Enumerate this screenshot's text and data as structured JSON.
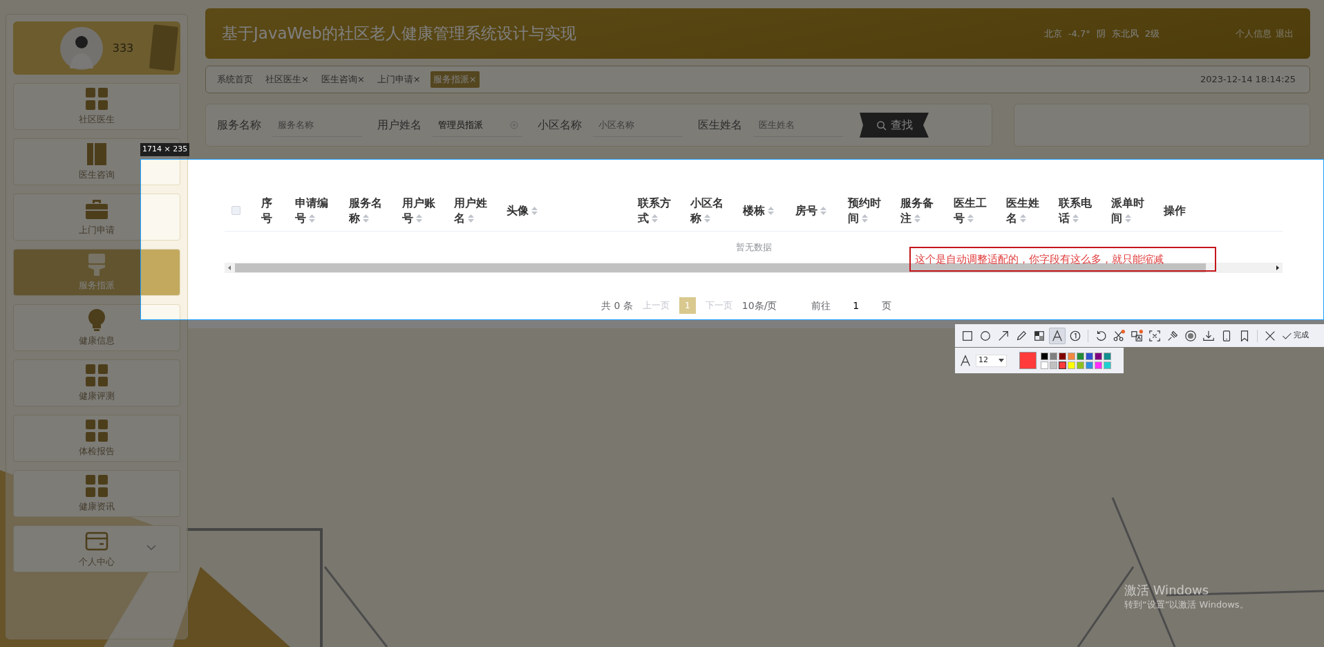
{
  "sidebar": {
    "user": {
      "name": "333"
    },
    "items": [
      {
        "label": "社区医生",
        "kind": "grid",
        "selected": false,
        "submenu": false
      },
      {
        "label": "医生咨询",
        "kind": "book",
        "selected": false,
        "submenu": false
      },
      {
        "label": "上门申请",
        "kind": "briefcase",
        "selected": false,
        "submenu": false
      },
      {
        "label": "服务指派",
        "kind": "brush",
        "selected": true,
        "submenu": false
      },
      {
        "label": "健康信息",
        "kind": "bulb",
        "selected": false,
        "submenu": false
      },
      {
        "label": "健康评测",
        "kind": "grid",
        "selected": false,
        "submenu": false
      },
      {
        "label": "体检报告",
        "kind": "grid",
        "selected": false,
        "submenu": false
      },
      {
        "label": "健康资讯",
        "kind": "grid",
        "selected": false,
        "submenu": false
      },
      {
        "label": "个人中心",
        "kind": "card",
        "selected": false,
        "submenu": true
      }
    ]
  },
  "header": {
    "title": "基于JavaWeb的社区老人健康管理系统设计与实现",
    "weather": [
      "北京",
      "-4.7°",
      "阴",
      "东北风",
      "2级"
    ],
    "links": [
      "个人信息",
      "退出"
    ]
  },
  "tabs": [
    {
      "label": "系统首页",
      "selected": false
    },
    {
      "label": "社区医生",
      "close": "×",
      "selected": false
    },
    {
      "label": "医生咨询",
      "close": "×",
      "selected": false
    },
    {
      "label": "上门申请",
      "close": "×",
      "selected": false
    },
    {
      "label": "服务指派",
      "close": "×",
      "selected": true
    }
  ],
  "clock": "2023-12-14 18:14:25",
  "search": {
    "fields": [
      {
        "label": "服务名称",
        "placeholder": "服务名称",
        "clearable": false
      },
      {
        "label": "用户姓名",
        "value": "管理员指派",
        "clearable": true
      },
      {
        "label": "小区名称",
        "placeholder": "小区名称",
        "clearable": false
      },
      {
        "label": "医生姓名",
        "placeholder": "医生姓名",
        "clearable": false
      }
    ],
    "button": "查找"
  },
  "table": {
    "select_all_checked": false,
    "columns": [
      {
        "label": "序号",
        "sortable": false
      },
      {
        "label": "申请编号",
        "sortable": true
      },
      {
        "label": "服务名称",
        "sortable": true
      },
      {
        "label": "用户账号",
        "sortable": true
      },
      {
        "label": "用户姓名",
        "sortable": true
      },
      {
        "label": "头像",
        "sortable": true
      },
      {
        "label": "联系方式",
        "sortable": true
      },
      {
        "label": "小区名称",
        "sortable": true
      },
      {
        "label": "楼栋",
        "sortable": true
      },
      {
        "label": "房号",
        "sortable": true
      },
      {
        "label": "预约时间",
        "sortable": true
      },
      {
        "label": "服务备注",
        "sortable": true
      },
      {
        "label": "医生工号",
        "sortable": true
      },
      {
        "label": "医生姓名",
        "sortable": true
      },
      {
        "label": "联系电话",
        "sortable": true
      },
      {
        "label": "派单时间",
        "sortable": true
      },
      {
        "label": "操作",
        "sortable": false
      }
    ],
    "empty_text": "暂无数据"
  },
  "pagination": {
    "total": "共 0 条",
    "prev": "上一页",
    "pages": [
      {
        "label": "1",
        "selected": true
      }
    ],
    "next": "下一页",
    "page_size": "10条/页",
    "goto_label": "前往",
    "goto_value": "1",
    "goto_suffix": "页"
  },
  "annotation": {
    "text": "这个是自动调整适配的，你字段有这么多，就只能缩减"
  },
  "capture": {
    "size_label": "1714 × 235",
    "tool_groups": [
      [
        {
          "kind": "rect",
          "selected": false,
          "badge": false
        },
        {
          "kind": "ellipse",
          "selected": false,
          "badge": false
        },
        {
          "kind": "arrow",
          "selected": false,
          "badge": false
        },
        {
          "kind": "pen",
          "selected": false,
          "badge": false
        },
        {
          "kind": "mosaic",
          "selected": false,
          "badge": false
        },
        {
          "kind": "text",
          "selected": true,
          "badge": false
        },
        {
          "kind": "number",
          "selected": false,
          "badge": false
        }
      ],
      [
        {
          "kind": "undo",
          "selected": false,
          "badge": false
        },
        {
          "kind": "scissors",
          "selected": false,
          "badge": true
        },
        {
          "kind": "translate",
          "selected": false,
          "badge": true
        },
        {
          "kind": "scan",
          "selected": false,
          "badge": false
        },
        {
          "kind": "pin",
          "selected": false,
          "badge": false
        },
        {
          "kind": "record",
          "selected": false,
          "badge": false
        },
        {
          "kind": "download",
          "selected": false,
          "badge": false
        },
        {
          "kind": "phone",
          "selected": false,
          "badge": false
        },
        {
          "kind": "bookmark",
          "selected": false,
          "badge": false
        }
      ],
      [
        {
          "kind": "close",
          "selected": false,
          "badge": false
        }
      ]
    ],
    "done": "完成",
    "font_size": "12",
    "palette": [
      {
        "color": "#000000",
        "selected": false
      },
      {
        "color": "#808080",
        "selected": false
      },
      {
        "color": "#800000",
        "selected": false
      },
      {
        "color": "#f08840",
        "selected": false
      },
      {
        "color": "#228b3a",
        "selected": false
      },
      {
        "color": "#3050d0",
        "selected": false
      },
      {
        "color": "#800080",
        "selected": false
      },
      {
        "color": "#109090",
        "selected": false
      },
      {
        "color": "#ffffff",
        "selected": false
      },
      {
        "color": "#c0c0c0",
        "selected": false
      },
      {
        "color": "#ff3b3b",
        "selected": true
      },
      {
        "color": "#ffff00",
        "selected": false
      },
      {
        "color": "#90c020",
        "selected": false
      },
      {
        "color": "#3090e0",
        "selected": false
      },
      {
        "color": "#ff30ff",
        "selected": false
      },
      {
        "color": "#20d0d0",
        "selected": false
      }
    ]
  },
  "os_notice": {
    "title": "激活 Windows",
    "subtitle": "转到“设置”以激活 Windows。"
  }
}
